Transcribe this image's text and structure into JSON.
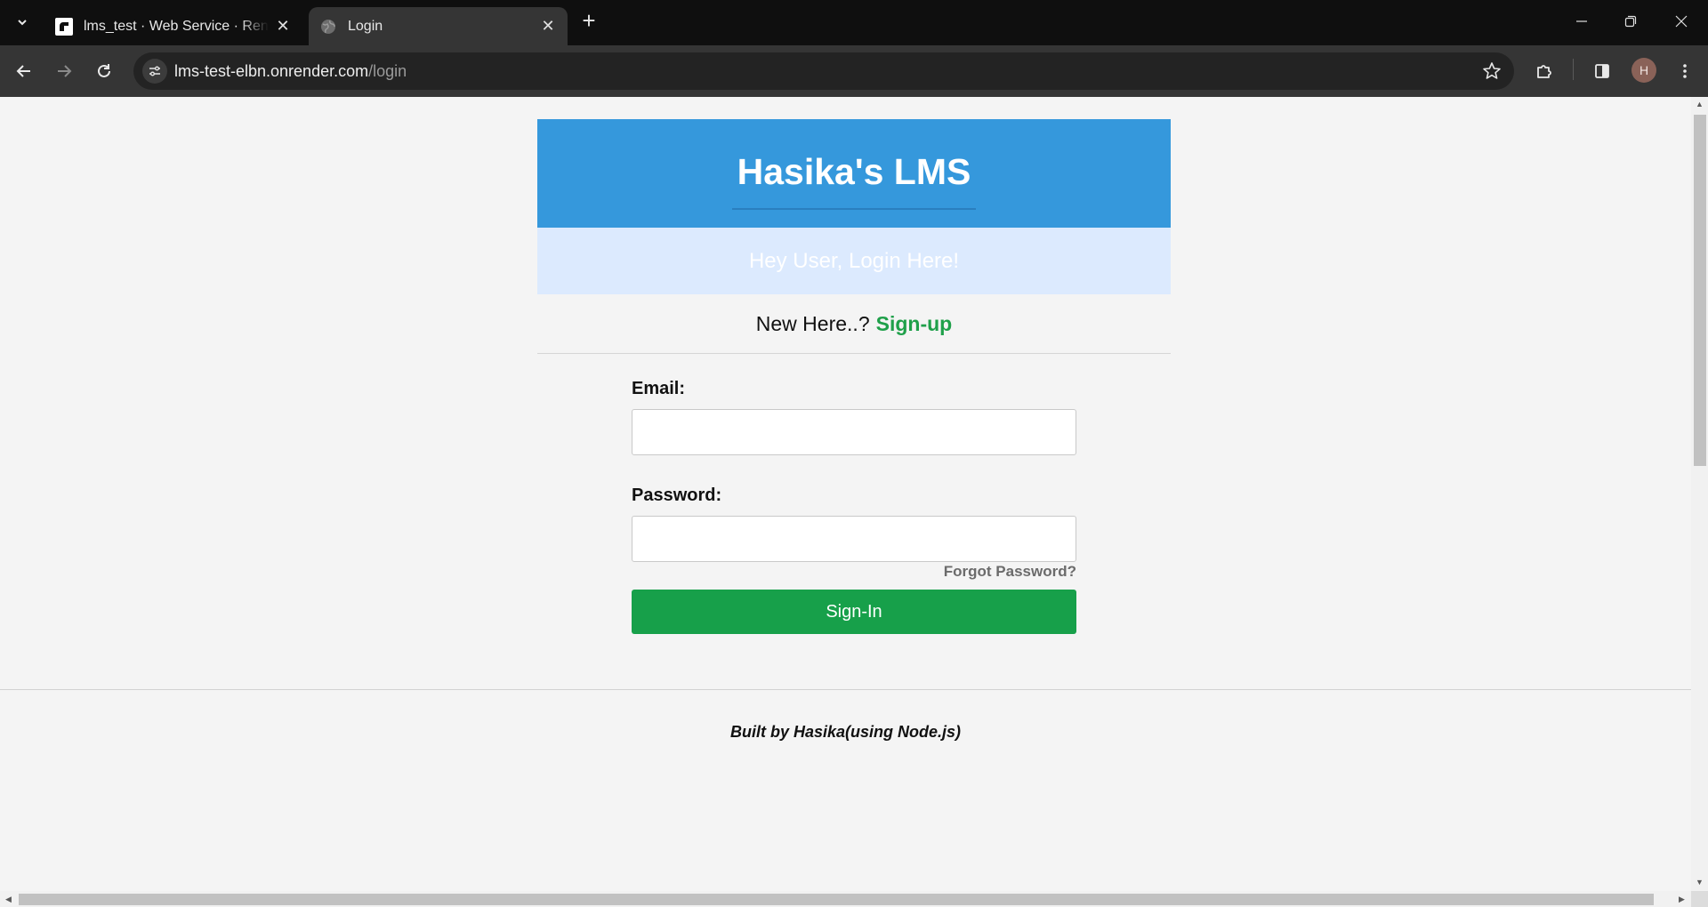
{
  "browser": {
    "tabs": [
      {
        "title": "lms_test · Web Service · Render",
        "active": false
      },
      {
        "title": "Login",
        "active": true
      }
    ],
    "url_host": "lms-test-elbn.onrender.com",
    "url_path": "/login",
    "profile_initial": "H",
    "colors": {
      "tabbar": "#0f0f0f",
      "toolbar": "#353535"
    }
  },
  "page": {
    "app_title": "Hasika's LMS",
    "subtitle": "Hey User, Login Here!",
    "new_here_text": "New Here..?",
    "signup_link": "Sign-up",
    "email_label": "Email:",
    "email_value": "",
    "password_label": "Password:",
    "password_value": "",
    "forgot_password": "Forgot Password?",
    "signin_button": "Sign-In",
    "footer_text": "Built by Hasika(using Node.js)",
    "colors": {
      "hero": "#3598dc",
      "subhero": "#dceafe",
      "accent_green": "#17a04a"
    }
  }
}
